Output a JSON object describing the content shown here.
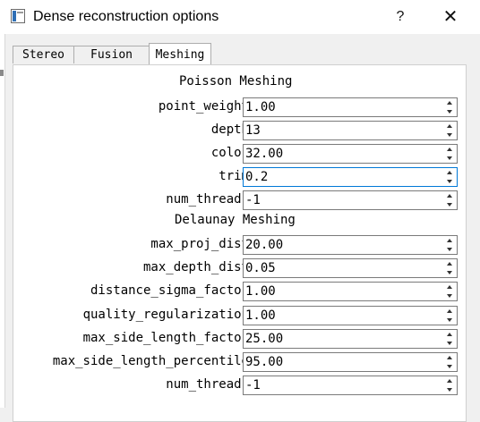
{
  "window": {
    "title": "Dense reconstruction options",
    "help_symbol": "?",
    "close_symbol": "✕"
  },
  "tabs": [
    {
      "label": "Stereo",
      "active": false
    },
    {
      "label": "Fusion",
      "active": false
    },
    {
      "label": "Meshing",
      "active": true
    }
  ],
  "poisson": {
    "title": "Poisson Meshing",
    "fields": [
      {
        "label": "point_weight",
        "value": "1.00"
      },
      {
        "label": "depth",
        "value": "13"
      },
      {
        "label": "color",
        "value": "32.00"
      },
      {
        "label": "trim",
        "value": "0.2",
        "focused": true
      },
      {
        "label": "num_threads",
        "value": "-1"
      }
    ]
  },
  "delaunay": {
    "title": "Delaunay Meshing",
    "fields": [
      {
        "label": "max_proj_dist",
        "value": "20.00"
      },
      {
        "label": "max_depth_dist",
        "value": "0.05"
      },
      {
        "label": "distance_sigma_factor",
        "value": "1.00"
      },
      {
        "label": "quality_regularization",
        "value": "1.00"
      },
      {
        "label": "max_side_length_factor",
        "value": "25.00"
      },
      {
        "label": "max_side_length_percentile",
        "value": "95.00"
      },
      {
        "label": "num_threads",
        "value": "-1"
      }
    ]
  },
  "colors": {
    "focus_border": "#0078d7",
    "field_border": "#7a7a7a",
    "background": "#f0f0f0"
  },
  "icons": {
    "app": "window-app-icon",
    "help": "help-icon",
    "close": "close-icon",
    "spin_up": "chevron-up-icon",
    "spin_down": "chevron-down-icon"
  }
}
